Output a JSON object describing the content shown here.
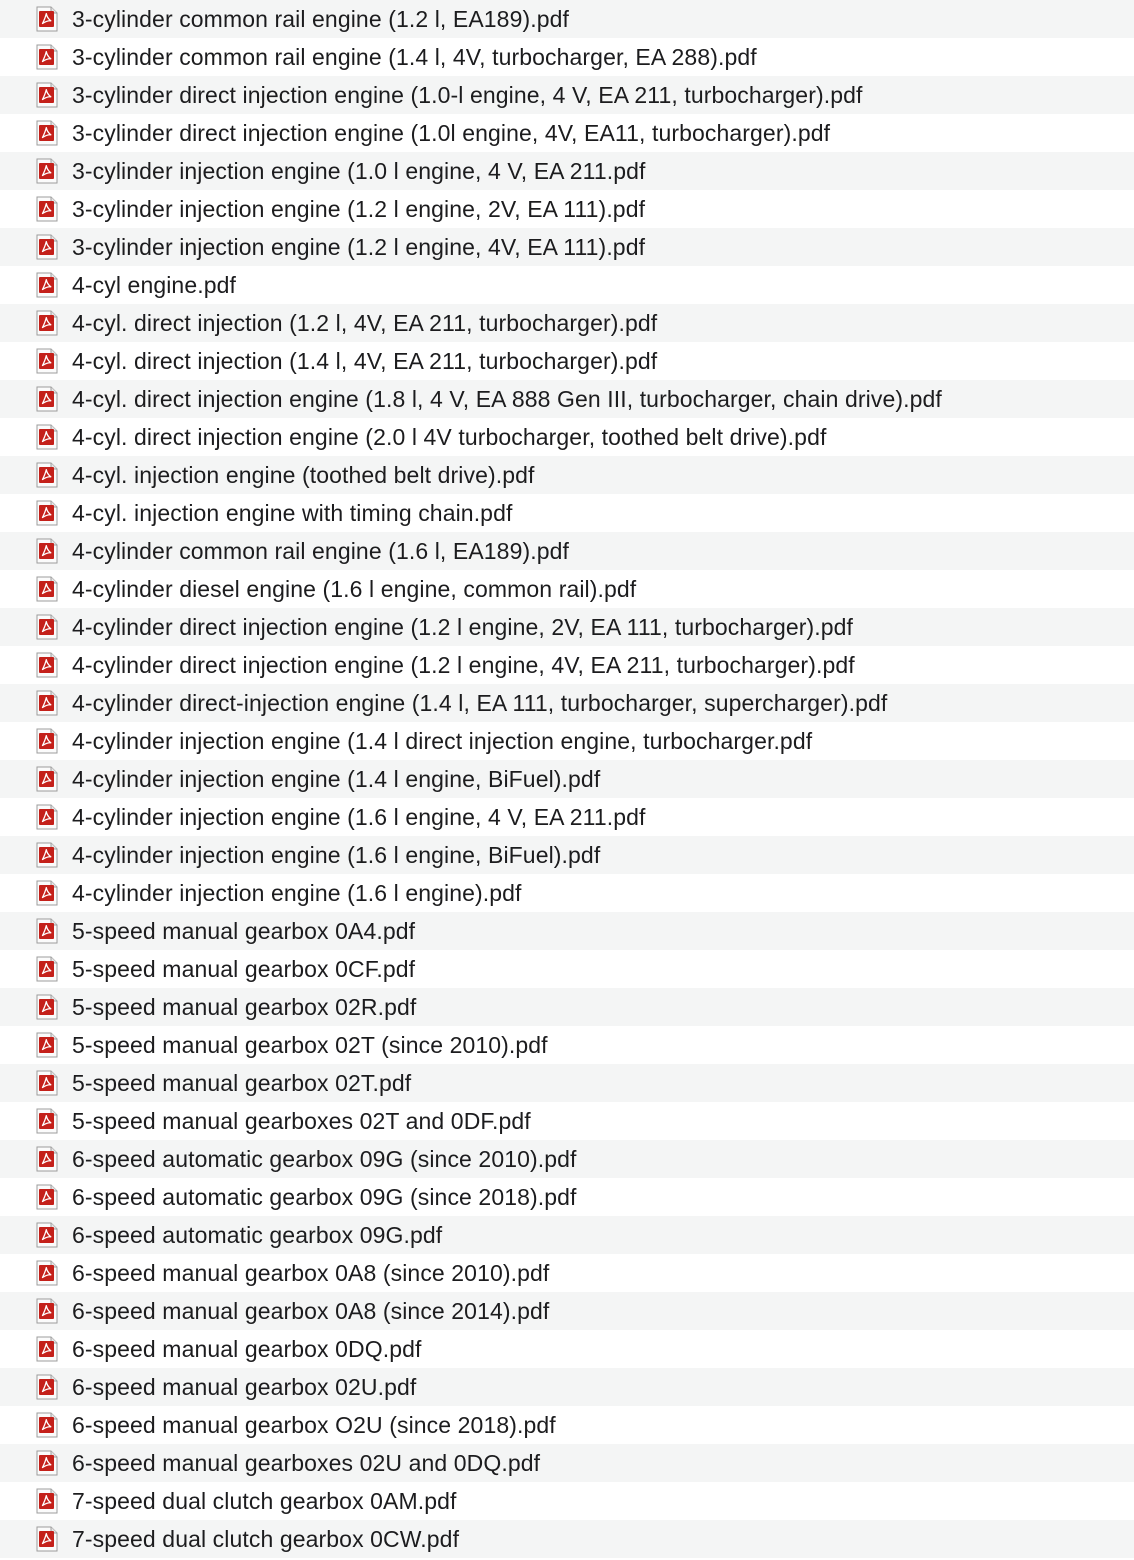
{
  "colors": {
    "row_alt": "#f4f5f5",
    "row": "#ffffff",
    "text": "#1c1c1e",
    "pdf_icon": "#c4201a"
  },
  "icon": "pdf-file-icon",
  "files": [
    "3-cylinder common rail engine (1.2 l, EA189).pdf",
    "3-cylinder common rail engine (1.4 l, 4V, turbocharger, EA 288).pdf",
    "3-cylinder direct injection engine (1.0-l engine, 4 V, EA 211, turbocharger).pdf",
    "3-cylinder direct injection engine (1.0l engine, 4V, EA11, turbocharger).pdf",
    "3-cylinder injection engine (1.0 l engine, 4 V, EA 211.pdf",
    "3-cylinder injection engine (1.2 l engine, 2V, EA 111).pdf",
    "3-cylinder injection engine (1.2 l engine, 4V, EA 111).pdf",
    "4-cyl engine.pdf",
    "4-cyl. direct injection (1.2 l, 4V, EA 211, turbocharger).pdf",
    "4-cyl. direct injection (1.4 l, 4V, EA 211, turbocharger).pdf",
    "4-cyl. direct injection engine (1.8 l, 4 V, EA 888 Gen III, turbocharger, chain drive).pdf",
    "4-cyl. direct injection engine (2.0 l 4V turbocharger, toothed belt drive).pdf",
    "4-cyl. injection engine (toothed belt drive).pdf",
    "4-cyl. injection engine with timing chain.pdf",
    "4-cylinder common rail engine (1.6 l, EA189).pdf",
    "4-cylinder diesel engine (1.6 l engine, common rail).pdf",
    "4-cylinder direct injection engine (1.2 l engine, 2V, EA 111, turbocharger).pdf",
    "4-cylinder direct injection engine (1.2 l engine, 4V, EA 211, turbocharger).pdf",
    "4-cylinder direct-injection engine (1.4 l, EA 111, turbocharger, supercharger).pdf",
    "4-cylinder injection engine (1.4 l direct injection engine, turbocharger.pdf",
    "4-cylinder injection engine (1.4 l engine, BiFuel).pdf",
    "4-cylinder injection engine (1.6 l engine, 4 V, EA 211.pdf",
    "4-cylinder injection engine (1.6 l engine, BiFuel).pdf",
    "4-cylinder injection engine (1.6 l engine).pdf",
    "5-speed manual gearbox 0A4.pdf",
    "5-speed manual gearbox 0CF.pdf",
    "5-speed manual gearbox 02R.pdf",
    "5-speed manual gearbox 02T (since 2010).pdf",
    "5-speed manual gearbox 02T.pdf",
    "5-speed manual gearboxes 02T and 0DF.pdf",
    "6-speed automatic gearbox 09G (since 2010).pdf",
    "6-speed automatic gearbox 09G (since 2018).pdf",
    "6-speed automatic gearbox 09G.pdf",
    "6-speed manual gearbox 0A8 (since 2010).pdf",
    "6-speed manual gearbox 0A8 (since 2014).pdf",
    "6-speed manual gearbox 0DQ.pdf",
    "6-speed manual gearbox 02U.pdf",
    "6-speed manual gearbox O2U (since 2018).pdf",
    "6-speed manual gearboxes 02U and 0DQ.pdf",
    "7-speed dual clutch gearbox 0AM.pdf",
    "7-speed dual clutch gearbox 0CW.pdf"
  ]
}
